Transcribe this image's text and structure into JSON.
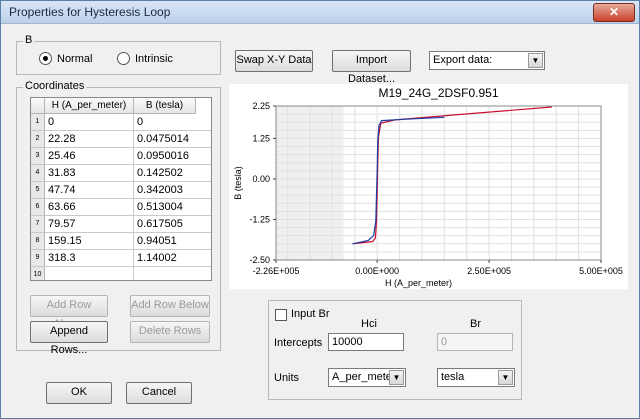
{
  "window": {
    "title": "Properties for Hysteresis Loop",
    "close_glyph": "✕"
  },
  "b_group": {
    "label": "B",
    "options": [
      {
        "label": "Normal",
        "selected": true
      },
      {
        "label": "Intrinsic",
        "selected": false
      }
    ]
  },
  "toolbar": {
    "swap": "Swap X-Y Data",
    "import": "Import Dataset...",
    "export_value": "Export data:"
  },
  "coordinates": {
    "label": "Coordinates",
    "columns": [
      "H (A_per_meter)",
      "B (tesla)"
    ],
    "rows": [
      {
        "n": "1",
        "h": "0",
        "b": "0"
      },
      {
        "n": "2",
        "h": "22.28",
        "b": "0.0475014"
      },
      {
        "n": "3",
        "h": "25.46",
        "b": "0.0950016"
      },
      {
        "n": "4",
        "h": "31.83",
        "b": "0.142502"
      },
      {
        "n": "5",
        "h": "47.74",
        "b": "0.342003"
      },
      {
        "n": "6",
        "h": "63.66",
        "b": "0.513004"
      },
      {
        "n": "7",
        "h": "79.57",
        "b": "0.617505"
      },
      {
        "n": "8",
        "h": "159.15",
        "b": "0.94051"
      },
      {
        "n": "9",
        "h": "318.3",
        "b": "1.14002"
      },
      {
        "n": "10",
        "h": "",
        "b": ""
      }
    ],
    "buttons": {
      "add_above": "Add Row Above",
      "add_below": "Add Row Below",
      "append": "Append Rows...",
      "delete": "Delete Rows"
    }
  },
  "chart_data": {
    "type": "line",
    "title": "M19_24G_2DSF0.951",
    "xlabel": "H (A_per_meter)",
    "ylabel": "B (tesla)",
    "x_ticks": [
      "-2.26E+005",
      "0.00E+000",
      "2.50E+005",
      "5.00E+005"
    ],
    "y_ticks": [
      "2.25",
      "1.25",
      "0.00",
      "-1.25",
      "-2.50"
    ],
    "xlim": [
      -226000,
      500000
    ],
    "ylim": [
      -2.5,
      2.25
    ],
    "series": [
      {
        "color": "#c8102e",
        "x": [
          -55000,
          -10000,
          -4000,
          -1500,
          0,
          1500,
          3000,
          8000,
          40000,
          160000,
          390000
        ],
        "y": [
          -2.0,
          -1.93,
          -1.82,
          -1.3,
          -0.4,
          0.5,
          1.3,
          1.72,
          1.82,
          1.96,
          2.22
        ]
      },
      {
        "color": "#1d3ea6",
        "x": [
          -55000,
          -20000,
          -8000,
          -3000,
          -1500,
          0,
          1500,
          4000,
          10000,
          60000,
          150000
        ],
        "y": [
          -2.0,
          -1.9,
          -1.75,
          -1.3,
          -0.5,
          0.3,
          1.2,
          1.65,
          1.8,
          1.84,
          1.9
        ]
      }
    ],
    "grid": true
  },
  "intercepts": {
    "input_br_label": "Input Br",
    "hci_header": "Hci",
    "br_header": "Br",
    "row_label": "Intercepts",
    "hci_value": "10000",
    "br_value": "0",
    "units_label": "Units",
    "hci_unit": "A_per_meter",
    "br_unit": "tesla"
  },
  "footer": {
    "ok": "OK",
    "cancel": "Cancel"
  }
}
